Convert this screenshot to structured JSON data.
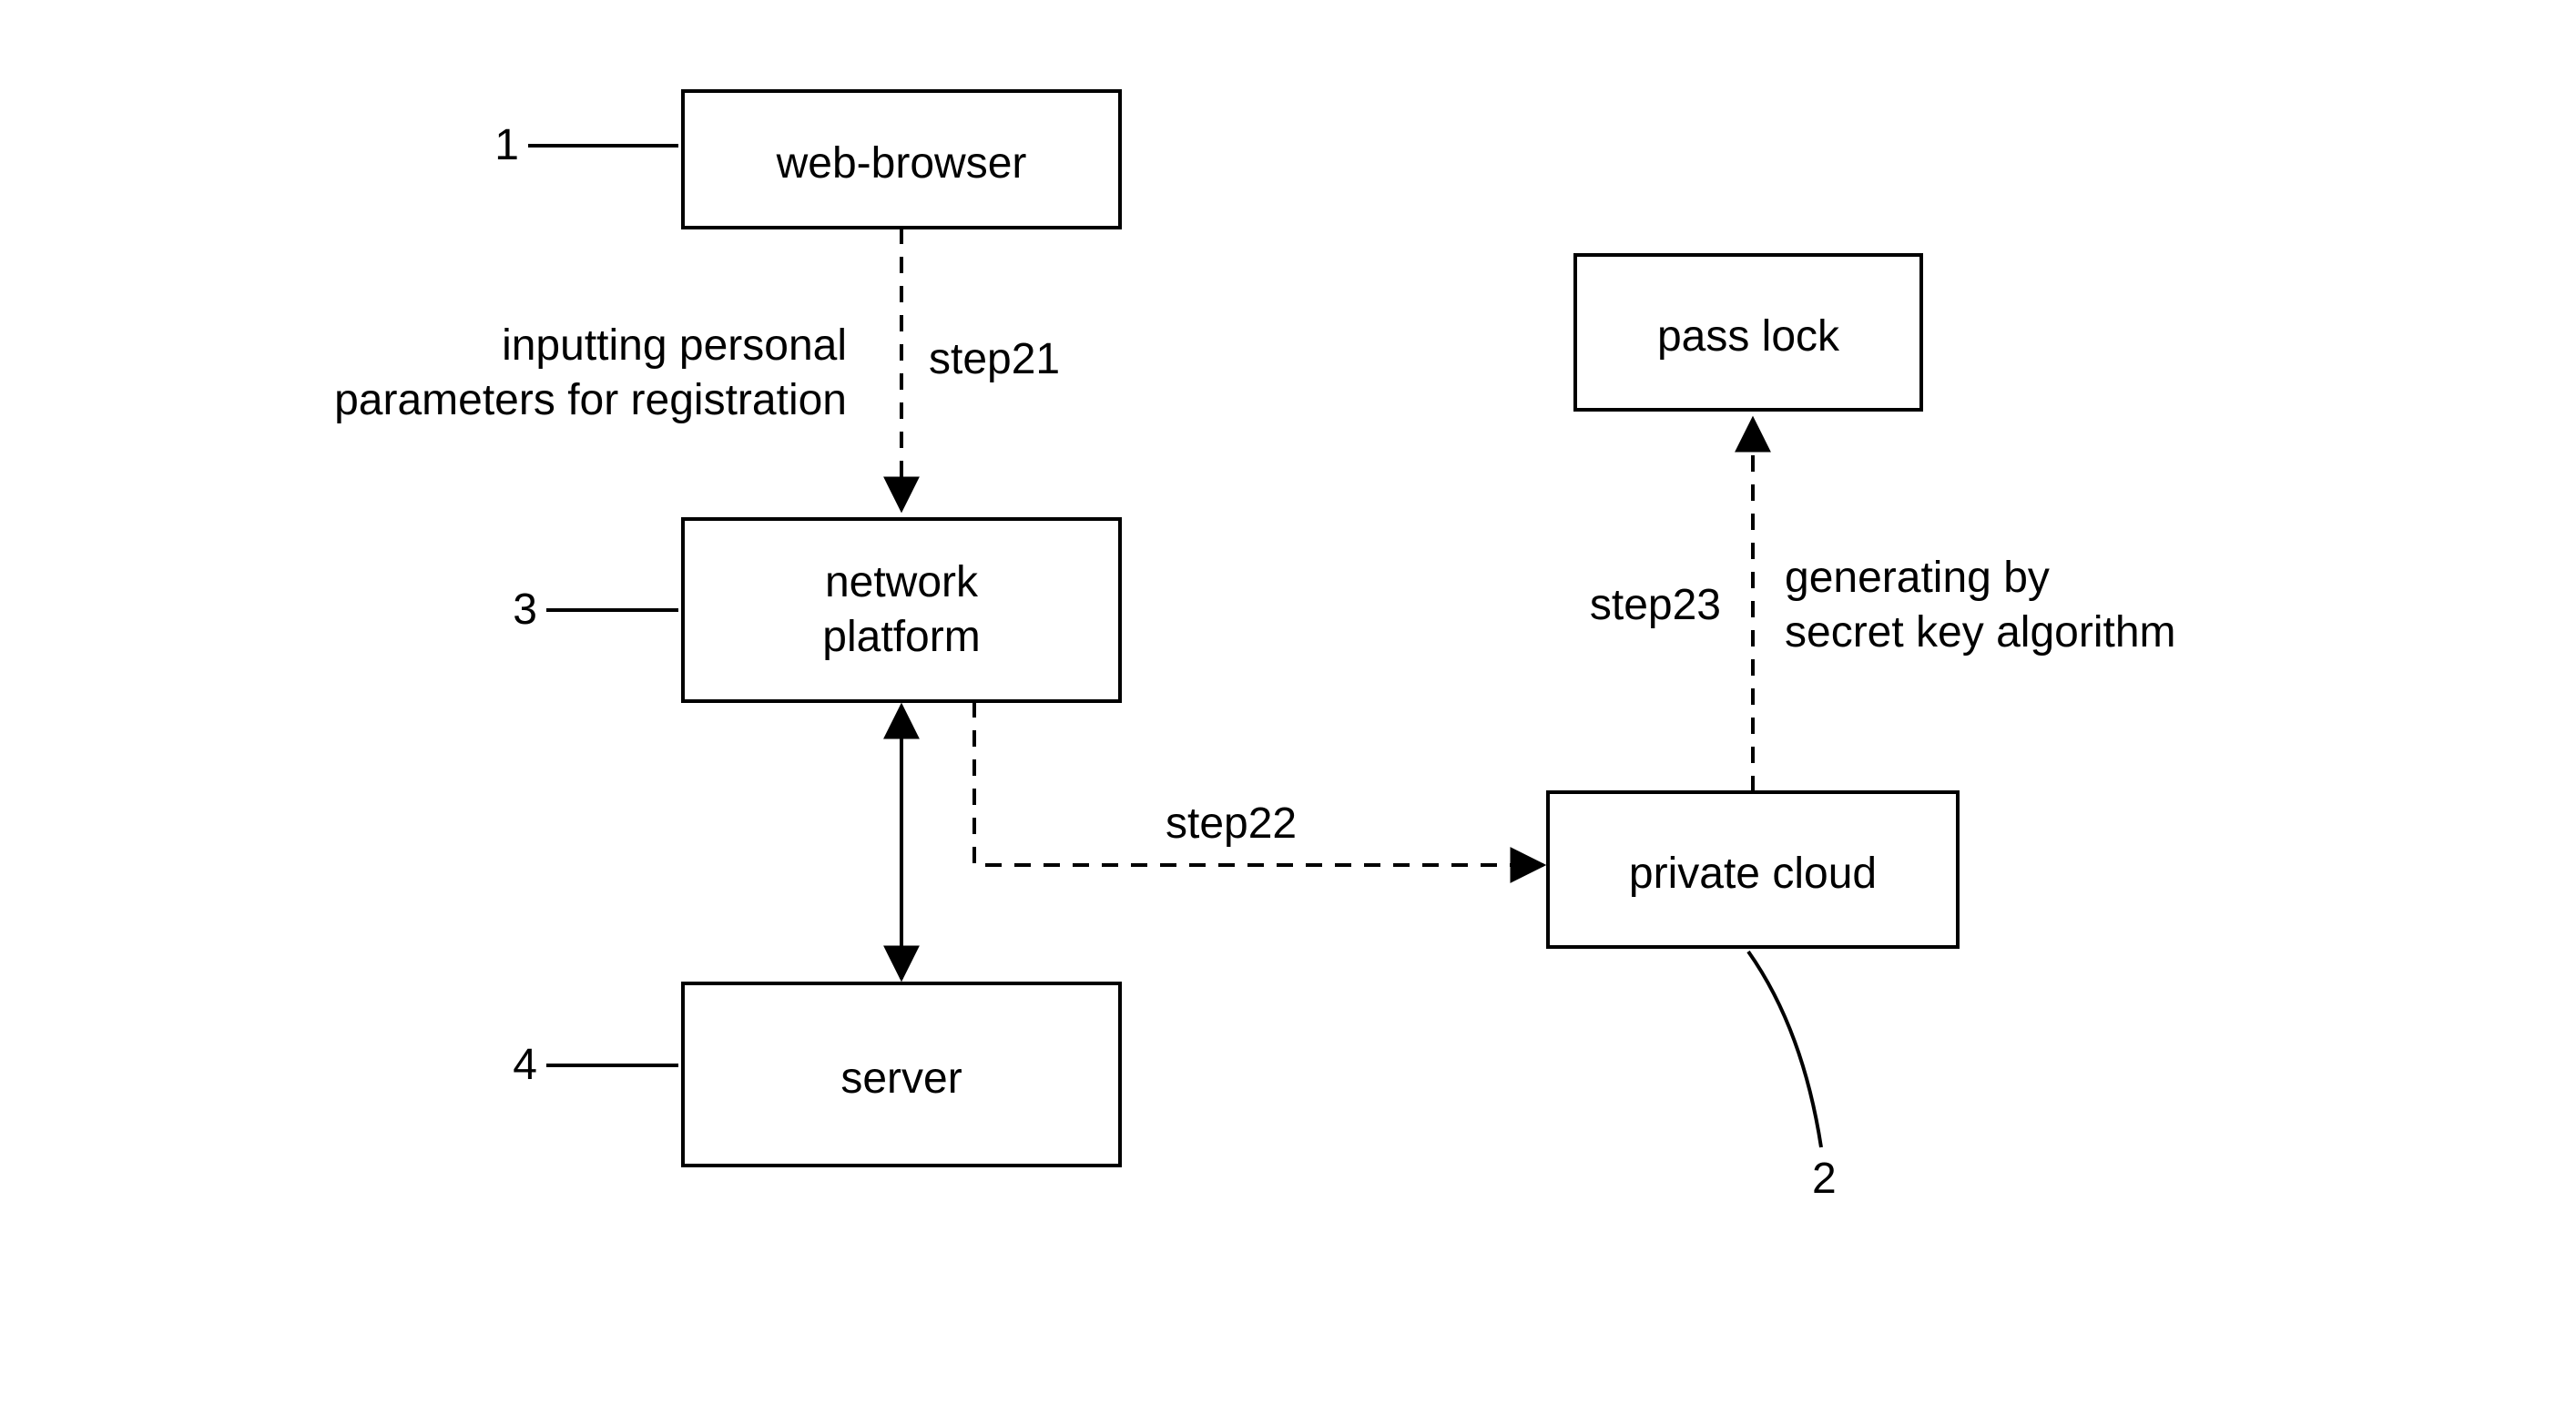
{
  "nodes": {
    "web_browser": {
      "label": "web-browser",
      "ref": "1"
    },
    "network_platform": {
      "label": "network platform",
      "ref": "3"
    },
    "server": {
      "label": "server",
      "ref": "4"
    },
    "private_cloud": {
      "label": "private cloud",
      "ref": "2"
    },
    "pass_lock": {
      "label": "pass lock"
    }
  },
  "edges": {
    "step21": {
      "label": "step21",
      "side_label": [
        "inputting personal",
        "parameters for registration"
      ]
    },
    "step22": {
      "label": "step22"
    },
    "step23": {
      "label": "step23",
      "side_label": [
        "generating by",
        "secret key algorithm"
      ]
    }
  }
}
